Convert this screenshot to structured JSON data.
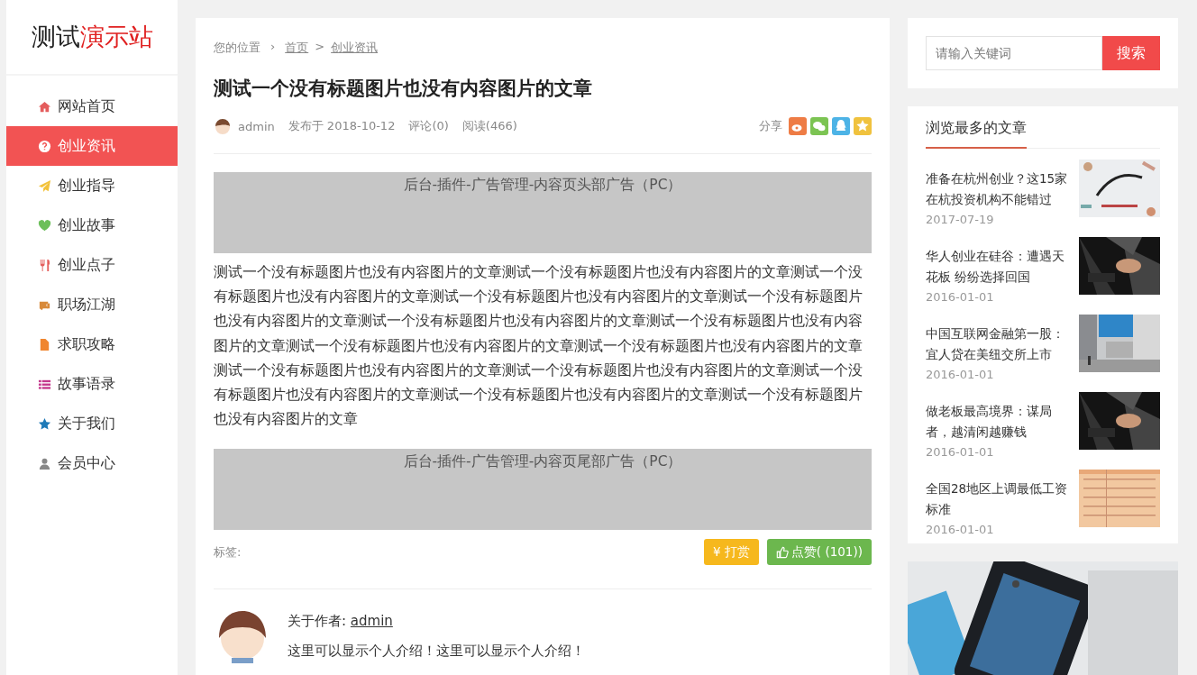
{
  "logo": {
    "part_1": "测试",
    "part_2": "演示站"
  },
  "nav": [
    {
      "label": "网站首页",
      "selected": false
    },
    {
      "label": "创业资讯",
      "selected": true
    },
    {
      "label": "创业指导",
      "selected": false
    },
    {
      "label": "创业故事",
      "selected": false
    },
    {
      "label": "创业点子",
      "selected": false
    },
    {
      "label": "职场江湖",
      "selected": false
    },
    {
      "label": "求职攻略",
      "selected": false
    },
    {
      "label": "故事语录",
      "selected": false
    },
    {
      "label": "关于我们",
      "selected": false
    },
    {
      "label": "会员中心",
      "selected": false
    }
  ],
  "breadcrumb": {
    "label": "您的位置",
    "arrow": "›",
    "separator": ">",
    "items": [
      {
        "text": "首页"
      },
      {
        "text": "创业资讯"
      }
    ]
  },
  "article": {
    "title": "测试一个没有标题图片也没有内容图片的文章",
    "author": "admin",
    "date": "发布于 2018-10-12",
    "comments": "评论(0)",
    "views": "阅读(466)",
    "share_label": "分享",
    "share": [
      {
        "kind": "weibo",
        "color": "#ee7c45"
      },
      {
        "kind": "wechat",
        "color": "#7cc453"
      },
      {
        "kind": "qq",
        "color": "#4db3e6"
      },
      {
        "kind": "qzone",
        "color": "#f0c23e"
      }
    ],
    "ad_top": "后台-插件-广告管理-内容页头部广告（PC）",
    "body": "测试一个没有标题图片也没有内容图片的文章测试一个没有标题图片也没有内容图片的文章测试一个没有标题图片也没有内容图片的文章测试一个没有标题图片也没有内容图片的文章测试一个没有标题图片也没有内容图片的文章测试一个没有标题图片也没有内容图片的文章测试一个没有标题图片也没有内容图片的文章测试一个没有标题图片也没有内容图片的文章测试一个没有标题图片也没有内容图片的文章测试一个没有标题图片也没有内容图片的文章测试一个没有标题图片也没有内容图片的文章测试一个没有标题图片也没有内容图片的文章测试一个没有标题图片也没有内容图片的文章测试一个没有标题图片也没有内容图片的文章",
    "ad_bottom": "后台-插件-广告管理-内容页尾部广告（PC）",
    "tags_label": "标签:",
    "reward_button": "¥ 打赏",
    "like_button": "点赞( (101))"
  },
  "author_box": {
    "label": "关于作者:",
    "name": "admin",
    "bio": "这里可以显示个人介绍！这里可以显示个人介绍！"
  },
  "search": {
    "placeholder": "请输入关键词",
    "button": "搜索"
  },
  "popular": {
    "title": "浏览最多的文章",
    "items": [
      {
        "title": "准备在杭州创业？这15家在杭投资机构不能错过",
        "date": "2017-07-19"
      },
      {
        "title": "华人创业在硅谷：遭遇天花板 纷纷选择回国",
        "date": "2016-01-01"
      },
      {
        "title": "中国互联网金融第一股：宜人贷在美纽交所上市",
        "date": "2016-01-01"
      },
      {
        "title": "做老板最高境界：谋局者，越清闲越赚钱",
        "date": "2016-01-01"
      },
      {
        "title": "全国28地区上调最低工资标准",
        "date": "2016-01-01"
      }
    ]
  }
}
